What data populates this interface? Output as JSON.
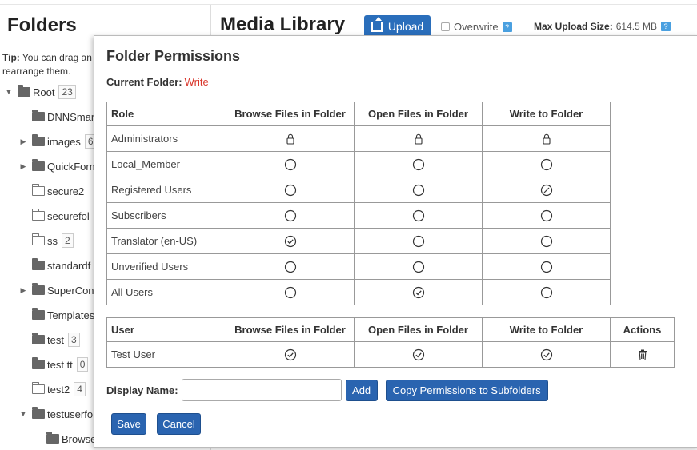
{
  "left_panel": {
    "title": "Folders",
    "tip_label": "Tip:",
    "tip_text": "You can drag an",
    "tip_text_line2": "rearrange them.",
    "tree": [
      {
        "label": "Root",
        "count": "23",
        "expander": "expanded",
        "icon": "folder-filled"
      },
      {
        "label": "DNNSmar",
        "count": "",
        "expander": "none",
        "icon": "folder-filled"
      },
      {
        "label": "images",
        "count": "6",
        "expander": "collapsed",
        "icon": "folder-filled"
      },
      {
        "label": "QuickForm",
        "count": "",
        "expander": "collapsed",
        "icon": "folder-filled"
      },
      {
        "label": "secure2",
        "count": "",
        "expander": "none",
        "icon": "folder-outline"
      },
      {
        "label": "securefol",
        "count": "",
        "expander": "none",
        "icon": "folder-outline"
      },
      {
        "label": "ss",
        "count": "2",
        "expander": "none",
        "icon": "folder-outline"
      },
      {
        "label": "standardf",
        "count": "",
        "expander": "none",
        "icon": "folder-filled"
      },
      {
        "label": "SuperCon",
        "count": "",
        "expander": "collapsed",
        "icon": "folder-filled"
      },
      {
        "label": "Templates",
        "count": "",
        "expander": "none",
        "icon": "folder-filled"
      },
      {
        "label": "test",
        "count": "3",
        "expander": "none",
        "icon": "folder-filled"
      },
      {
        "label": "test tt",
        "count": "0",
        "expander": "none",
        "icon": "folder-filled"
      },
      {
        "label": "test2",
        "count": "4",
        "expander": "none",
        "icon": "folder-outline"
      },
      {
        "label": "testuserfo",
        "count": "",
        "expander": "expanded",
        "icon": "folder-filled"
      },
      {
        "label": "Browse",
        "count": "",
        "expander": "none",
        "icon": "folder-filled"
      }
    ]
  },
  "header": {
    "title": "Media Library",
    "upload_label": "Upload",
    "overwrite_label": "Overwrite",
    "max_upload_label": "Max Upload Size:",
    "max_upload_value": "614.5 MB",
    "help_glyph": "?"
  },
  "dialog": {
    "title": "Folder Permissions",
    "current_folder_label": "Current Folder:",
    "current_folder_value": "Write",
    "role_table": {
      "headers": [
        "Role",
        "Browse Files in Folder",
        "Open Files in Folder",
        "Write to Folder"
      ],
      "rows": [
        {
          "name": "Administrators",
          "perms": [
            "locked",
            "locked",
            "locked"
          ]
        },
        {
          "name": "Local_Member",
          "perms": [
            "none",
            "none",
            "none"
          ]
        },
        {
          "name": "Registered Users",
          "perms": [
            "none",
            "none",
            "denied"
          ]
        },
        {
          "name": "Subscribers",
          "perms": [
            "none",
            "none",
            "none"
          ]
        },
        {
          "name": "Translator (en-US)",
          "perms": [
            "granted",
            "none",
            "none"
          ]
        },
        {
          "name": "Unverified Users",
          "perms": [
            "none",
            "none",
            "none"
          ]
        },
        {
          "name": "All Users",
          "perms": [
            "none",
            "granted",
            "none"
          ]
        }
      ]
    },
    "user_table": {
      "headers": [
        "User",
        "Browse Files in Folder",
        "Open Files in Folder",
        "Write to Folder",
        "Actions"
      ],
      "rows": [
        {
          "name": "Test User",
          "perms": [
            "granted",
            "granted",
            "granted"
          ],
          "action": "delete"
        }
      ]
    },
    "display_name_label": "Display Name:",
    "display_name_value": "",
    "add_label": "Add",
    "copy_label": "Copy Permissions to Subfolders",
    "save_label": "Save",
    "cancel_label": "Cancel"
  },
  "colors": {
    "accent": "#2a64b0",
    "current_folder_value": "#d9362b",
    "help_icon": "#4aa0e0"
  }
}
